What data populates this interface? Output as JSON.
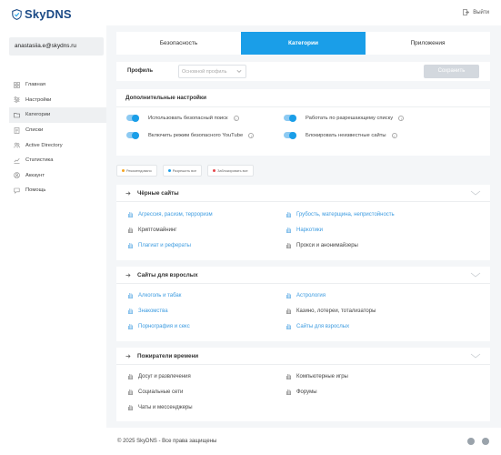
{
  "header": {
    "logo": "SkyDNS",
    "logout": "Выйти"
  },
  "sidebar": {
    "user": "anastasiia.e@skydns.ru",
    "items": [
      {
        "label": "Главная",
        "icon": "grid-icon"
      },
      {
        "label": "Настройки",
        "icon": "sliders-icon"
      },
      {
        "label": "Категории",
        "icon": "folder-icon",
        "active": true
      },
      {
        "label": "Списки",
        "icon": "list-icon"
      },
      {
        "label": "Active Directory",
        "icon": "people-icon"
      },
      {
        "label": "Статистика",
        "icon": "chart-icon"
      },
      {
        "label": "Аккаунт",
        "icon": "user-icon"
      },
      {
        "label": "Помощь",
        "icon": "help-icon"
      }
    ]
  },
  "tabs": [
    {
      "label": "Безопасность"
    },
    {
      "label": "Категории",
      "active": true
    },
    {
      "label": "Приложения"
    }
  ],
  "profile": {
    "label": "Профиль",
    "placeholder": "Основной профиль",
    "save": "Сохранить"
  },
  "extra": {
    "title": "Дополнительные настройки",
    "toggles": [
      {
        "label": "Использовать безопасный поиск",
        "on": true
      },
      {
        "label": "Включить режим безопасного YouTube",
        "on": true
      },
      {
        "label": "Работать по разрешающему списку",
        "on": true
      },
      {
        "label": "Блокировать неизвестные сайты",
        "on": true
      }
    ]
  },
  "legend": [
    {
      "label": "Рекомендовано",
      "color": "#f5a623"
    },
    {
      "label": "Разрешить все",
      "color": "#1a9ee8"
    },
    {
      "label": "Заблокировать все",
      "color": "#e5484d"
    }
  ],
  "categories": [
    {
      "title": "Чёрные сайты",
      "items": [
        {
          "label": "Агрессия, расизм, терроризм",
          "blue": true
        },
        {
          "label": "Криптомайнинг",
          "blue": false
        },
        {
          "label": "Плагиат и рефераты",
          "blue": true
        },
        {
          "label": "Грубость, матерщина, непристойность",
          "blue": true
        },
        {
          "label": "Наркотики",
          "blue": true
        },
        {
          "label": "Прокси и анонимайзеры",
          "blue": false
        }
      ]
    },
    {
      "title": "Сайты для взрослых",
      "items": [
        {
          "label": "Алкоголь и табак",
          "blue": true
        },
        {
          "label": "Знакомства",
          "blue": true
        },
        {
          "label": "Порнография и секс",
          "blue": true
        },
        {
          "label": "Астрология",
          "blue": true
        },
        {
          "label": "Казино, лотереи, тотализаторы",
          "blue": false
        },
        {
          "label": "Сайты для взрослых",
          "blue": true
        }
      ]
    },
    {
      "title": "Пожиратели времени",
      "items": [
        {
          "label": "Досуг и развлечения",
          "blue": false
        },
        {
          "label": "Социальные сети",
          "blue": false
        },
        {
          "label": "Чаты и мессенджеры",
          "blue": false
        },
        {
          "label": "Компьютерные игры",
          "blue": false
        },
        {
          "label": "Форумы",
          "blue": false
        }
      ]
    }
  ],
  "footer": {
    "copyright": "© 2025 SkyDNS - Все права защищены",
    "social": [
      "telegram-icon",
      "vk-icon"
    ]
  },
  "colors": {
    "accent": "#1a9ee8",
    "link": "#3c9be0",
    "brand": "#1b4a86"
  }
}
